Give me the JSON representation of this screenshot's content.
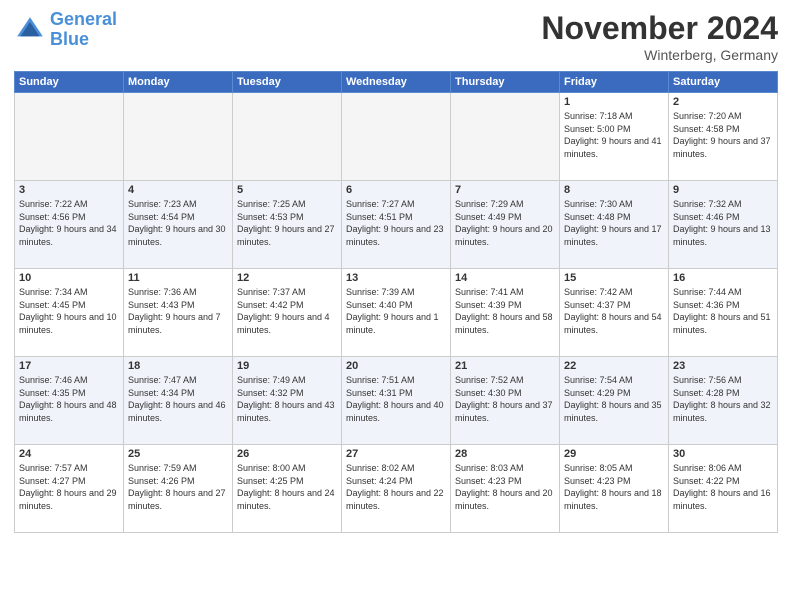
{
  "header": {
    "title": "November 2024",
    "location": "Winterberg, Germany",
    "logo_line1": "General",
    "logo_line2": "Blue"
  },
  "weekdays": [
    "Sunday",
    "Monday",
    "Tuesday",
    "Wednesday",
    "Thursday",
    "Friday",
    "Saturday"
  ],
  "weeks": [
    [
      {
        "day": "",
        "info": ""
      },
      {
        "day": "",
        "info": ""
      },
      {
        "day": "",
        "info": ""
      },
      {
        "day": "",
        "info": ""
      },
      {
        "day": "",
        "info": ""
      },
      {
        "day": "1",
        "info": "Sunrise: 7:18 AM\nSunset: 5:00 PM\nDaylight: 9 hours\nand 41 minutes."
      },
      {
        "day": "2",
        "info": "Sunrise: 7:20 AM\nSunset: 4:58 PM\nDaylight: 9 hours\nand 37 minutes."
      }
    ],
    [
      {
        "day": "3",
        "info": "Sunrise: 7:22 AM\nSunset: 4:56 PM\nDaylight: 9 hours\nand 34 minutes."
      },
      {
        "day": "4",
        "info": "Sunrise: 7:23 AM\nSunset: 4:54 PM\nDaylight: 9 hours\nand 30 minutes."
      },
      {
        "day": "5",
        "info": "Sunrise: 7:25 AM\nSunset: 4:53 PM\nDaylight: 9 hours\nand 27 minutes."
      },
      {
        "day": "6",
        "info": "Sunrise: 7:27 AM\nSunset: 4:51 PM\nDaylight: 9 hours\nand 23 minutes."
      },
      {
        "day": "7",
        "info": "Sunrise: 7:29 AM\nSunset: 4:49 PM\nDaylight: 9 hours\nand 20 minutes."
      },
      {
        "day": "8",
        "info": "Sunrise: 7:30 AM\nSunset: 4:48 PM\nDaylight: 9 hours\nand 17 minutes."
      },
      {
        "day": "9",
        "info": "Sunrise: 7:32 AM\nSunset: 4:46 PM\nDaylight: 9 hours\nand 13 minutes."
      }
    ],
    [
      {
        "day": "10",
        "info": "Sunrise: 7:34 AM\nSunset: 4:45 PM\nDaylight: 9 hours\nand 10 minutes."
      },
      {
        "day": "11",
        "info": "Sunrise: 7:36 AM\nSunset: 4:43 PM\nDaylight: 9 hours\nand 7 minutes."
      },
      {
        "day": "12",
        "info": "Sunrise: 7:37 AM\nSunset: 4:42 PM\nDaylight: 9 hours\nand 4 minutes."
      },
      {
        "day": "13",
        "info": "Sunrise: 7:39 AM\nSunset: 4:40 PM\nDaylight: 9 hours\nand 1 minute."
      },
      {
        "day": "14",
        "info": "Sunrise: 7:41 AM\nSunset: 4:39 PM\nDaylight: 8 hours\nand 58 minutes."
      },
      {
        "day": "15",
        "info": "Sunrise: 7:42 AM\nSunset: 4:37 PM\nDaylight: 8 hours\nand 54 minutes."
      },
      {
        "day": "16",
        "info": "Sunrise: 7:44 AM\nSunset: 4:36 PM\nDaylight: 8 hours\nand 51 minutes."
      }
    ],
    [
      {
        "day": "17",
        "info": "Sunrise: 7:46 AM\nSunset: 4:35 PM\nDaylight: 8 hours\nand 48 minutes."
      },
      {
        "day": "18",
        "info": "Sunrise: 7:47 AM\nSunset: 4:34 PM\nDaylight: 8 hours\nand 46 minutes."
      },
      {
        "day": "19",
        "info": "Sunrise: 7:49 AM\nSunset: 4:32 PM\nDaylight: 8 hours\nand 43 minutes."
      },
      {
        "day": "20",
        "info": "Sunrise: 7:51 AM\nSunset: 4:31 PM\nDaylight: 8 hours\nand 40 minutes."
      },
      {
        "day": "21",
        "info": "Sunrise: 7:52 AM\nSunset: 4:30 PM\nDaylight: 8 hours\nand 37 minutes."
      },
      {
        "day": "22",
        "info": "Sunrise: 7:54 AM\nSunset: 4:29 PM\nDaylight: 8 hours\nand 35 minutes."
      },
      {
        "day": "23",
        "info": "Sunrise: 7:56 AM\nSunset: 4:28 PM\nDaylight: 8 hours\nand 32 minutes."
      }
    ],
    [
      {
        "day": "24",
        "info": "Sunrise: 7:57 AM\nSunset: 4:27 PM\nDaylight: 8 hours\nand 29 minutes."
      },
      {
        "day": "25",
        "info": "Sunrise: 7:59 AM\nSunset: 4:26 PM\nDaylight: 8 hours\nand 27 minutes."
      },
      {
        "day": "26",
        "info": "Sunrise: 8:00 AM\nSunset: 4:25 PM\nDaylight: 8 hours\nand 24 minutes."
      },
      {
        "day": "27",
        "info": "Sunrise: 8:02 AM\nSunset: 4:24 PM\nDaylight: 8 hours\nand 22 minutes."
      },
      {
        "day": "28",
        "info": "Sunrise: 8:03 AM\nSunset: 4:23 PM\nDaylight: 8 hours\nand 20 minutes."
      },
      {
        "day": "29",
        "info": "Sunrise: 8:05 AM\nSunset: 4:23 PM\nDaylight: 8 hours\nand 18 minutes."
      },
      {
        "day": "30",
        "info": "Sunrise: 8:06 AM\nSunset: 4:22 PM\nDaylight: 8 hours\nand 16 minutes."
      }
    ]
  ]
}
